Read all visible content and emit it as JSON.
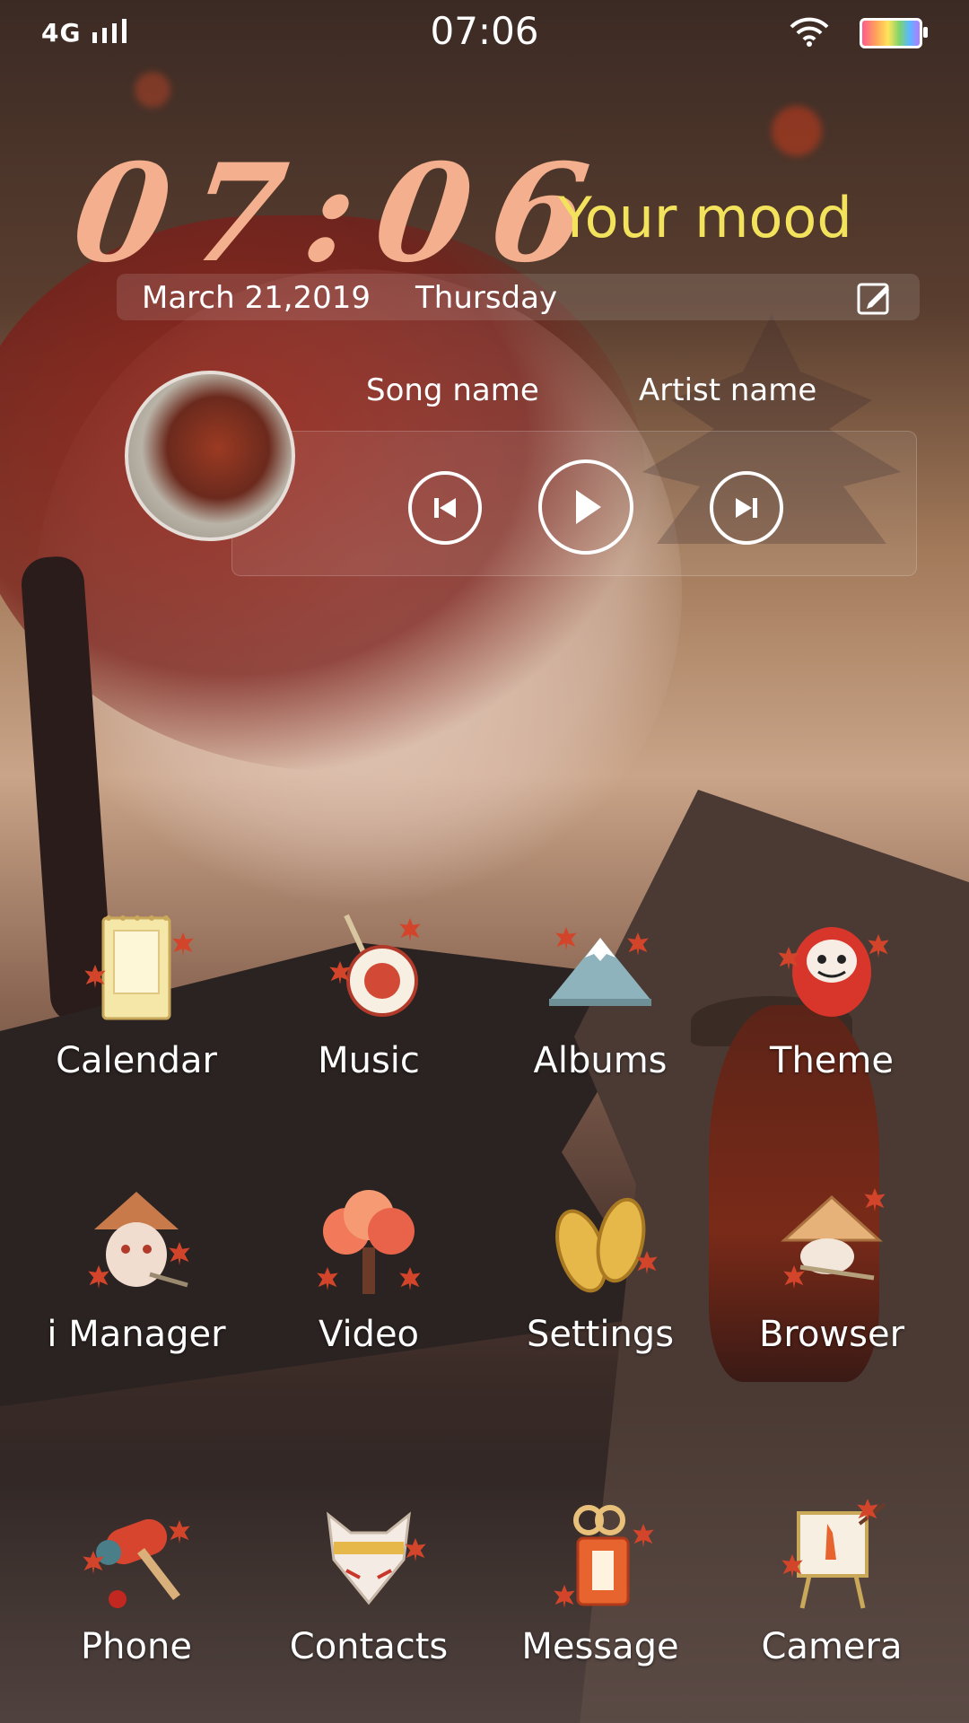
{
  "status_bar": {
    "signal": "4G",
    "time": "07:06"
  },
  "clock_widget": {
    "time": "07:06",
    "mood": "Your mood",
    "date": "March 21,2019",
    "weekday": "Thursday"
  },
  "music_widget": {
    "song_name": "Song name",
    "artist_name": "Artist name"
  },
  "apps": [
    {
      "label": "Calendar",
      "icon": "calendar-icon"
    },
    {
      "label": "Music",
      "icon": "music-icon"
    },
    {
      "label": "Albums",
      "icon": "albums-icon"
    },
    {
      "label": "Theme",
      "icon": "theme-icon"
    },
    {
      "label": "i Manager",
      "icon": "imanager-icon"
    },
    {
      "label": "Video",
      "icon": "video-icon"
    },
    {
      "label": "Settings",
      "icon": "settings-icon"
    },
    {
      "label": "Browser",
      "icon": "browser-icon"
    },
    {
      "label": "Phone",
      "icon": "phone-icon"
    },
    {
      "label": "Contacts",
      "icon": "contacts-icon"
    },
    {
      "label": "Message",
      "icon": "message-icon"
    },
    {
      "label": "Camera",
      "icon": "camera-icon"
    }
  ],
  "colors": {
    "clock": "#f4b08e",
    "mood": "#f3e35c"
  }
}
